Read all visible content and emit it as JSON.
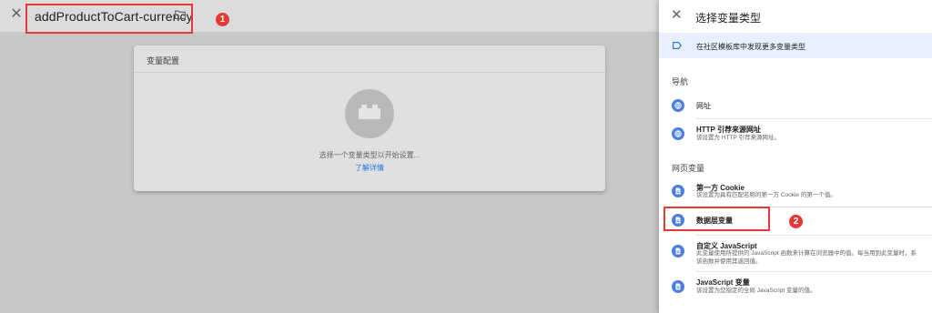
{
  "editor": {
    "close_icon": "close-icon",
    "title": "addProductToCart-currency",
    "folder_icon": "folder-icon",
    "badge_1": "1",
    "card": {
      "header": "变量配置",
      "message": "选择一个变量类型以开始设置...",
      "link": "了解详情"
    }
  },
  "panel": {
    "title": "选择变量类型",
    "community": "在社区模板库中发现更多变量类型",
    "sections": {
      "nav": "导航",
      "web": "网页变量"
    },
    "items": [
      {
        "name": "网址",
        "desc": ""
      },
      {
        "name": "HTTP 引荐来源网址",
        "desc": "该设置为 HTTP 引荐来源网址。"
      },
      {
        "name": "第一方 Cookie",
        "desc": "该设置为具有匹配名称的第一方 Cookie 的第一个值。"
      },
      {
        "name": "数据层变量",
        "desc": ""
      },
      {
        "name": "自定义 JavaScript",
        "desc": "此变量使用所提供的 JavaScript 函数来计算在浏览器中的值。每当用到此变量时，系",
        "desc2": "该函数并使用其返回值。"
      },
      {
        "name": "JavaScript 变量",
        "desc": "该设置为您指定的全局 JavaScript 变量的值。"
      }
    ],
    "badge_2": "2"
  },
  "colors": {
    "accent": "#1a73e8",
    "annotation_red": "#e53935",
    "icon_blue": "#4a7fe0"
  }
}
